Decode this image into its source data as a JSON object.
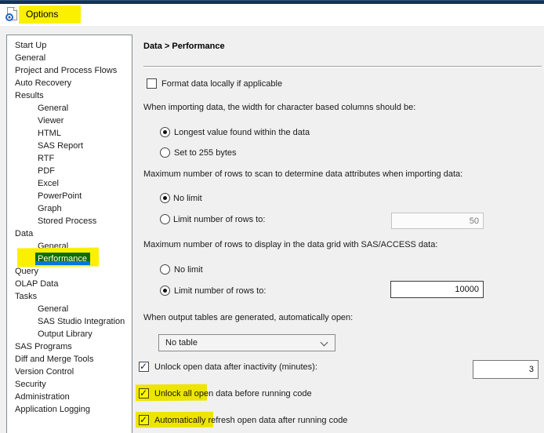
{
  "window": {
    "title": "Options"
  },
  "colors": {
    "selection_blue": "#0078d7",
    "highlighter_yellow": "#fbf000",
    "titlebar_navy": "#17304e",
    "dialog_background": "#f0f0f0"
  },
  "sidebar": {
    "items": [
      {
        "label": "Start Up",
        "level": 0
      },
      {
        "label": "General",
        "level": 0
      },
      {
        "label": "Project and Process Flows",
        "level": 0
      },
      {
        "label": "Auto Recovery",
        "level": 0
      },
      {
        "label": "Results",
        "level": 0
      },
      {
        "label": "General",
        "level": 1
      },
      {
        "label": "Viewer",
        "level": 1
      },
      {
        "label": "HTML",
        "level": 1
      },
      {
        "label": "SAS Report",
        "level": 1
      },
      {
        "label": "RTF",
        "level": 1
      },
      {
        "label": "PDF",
        "level": 1
      },
      {
        "label": "Excel",
        "level": 1
      },
      {
        "label": "PowerPoint",
        "level": 1
      },
      {
        "label": "Graph",
        "level": 1
      },
      {
        "label": "Stored Process",
        "level": 1
      },
      {
        "label": "Data",
        "level": 0
      },
      {
        "label": "General",
        "level": 1
      },
      {
        "label": "Performance",
        "level": 1,
        "selected": true,
        "highlighted": true
      },
      {
        "label": "Query",
        "level": 0
      },
      {
        "label": "OLAP Data",
        "level": 0
      },
      {
        "label": "Tasks",
        "level": 0
      },
      {
        "label": "General",
        "level": 1
      },
      {
        "label": "SAS Studio Integration",
        "level": 1
      },
      {
        "label": "Output Library",
        "level": 1
      },
      {
        "label": "SAS Programs",
        "level": 0
      },
      {
        "label": "Diff and Merge Tools",
        "level": 0
      },
      {
        "label": "Version Control",
        "level": 0
      },
      {
        "label": "Security",
        "level": 0
      },
      {
        "label": "Administration",
        "level": 0
      },
      {
        "label": "Application Logging",
        "level": 0
      }
    ]
  },
  "main": {
    "breadcrumb": "Data > Performance",
    "format_local": {
      "label": "Format data locally if applicable",
      "checked": false
    },
    "import_width": {
      "heading": "When importing data, the width for character based columns should be:",
      "option_longest": {
        "label": "Longest value found within the data",
        "selected": true
      },
      "option_255": {
        "label": "Set to 255 bytes",
        "selected": false
      }
    },
    "scan_rows": {
      "heading": "Maximum number of rows to scan to determine data attributes when importing data:",
      "option_no_limit": {
        "label": "No limit",
        "selected": true
      },
      "option_limit": {
        "label": "Limit number of rows to:",
        "selected": false,
        "value": "50",
        "enabled": false
      }
    },
    "display_rows": {
      "heading": "Maximum number of rows to display in the data grid with SAS/ACCESS data:",
      "option_no_limit": {
        "label": "No limit",
        "selected": false
      },
      "option_limit": {
        "label": "Limit number of rows to:",
        "selected": true,
        "value": "10000",
        "enabled": true
      }
    },
    "auto_open": {
      "heading": "When output tables are generated, automatically open:",
      "selected_value": "No table"
    },
    "unlock_inactivity": {
      "label": "Unlock open data after inactivity (minutes):",
      "checked": true,
      "value": "3"
    },
    "unlock_before_run": {
      "label": "Unlock all open data before running code",
      "checked": true,
      "highlighted": true
    },
    "auto_refresh": {
      "label": "Automatically refresh open data after running code",
      "checked": true,
      "highlighted": true
    }
  }
}
